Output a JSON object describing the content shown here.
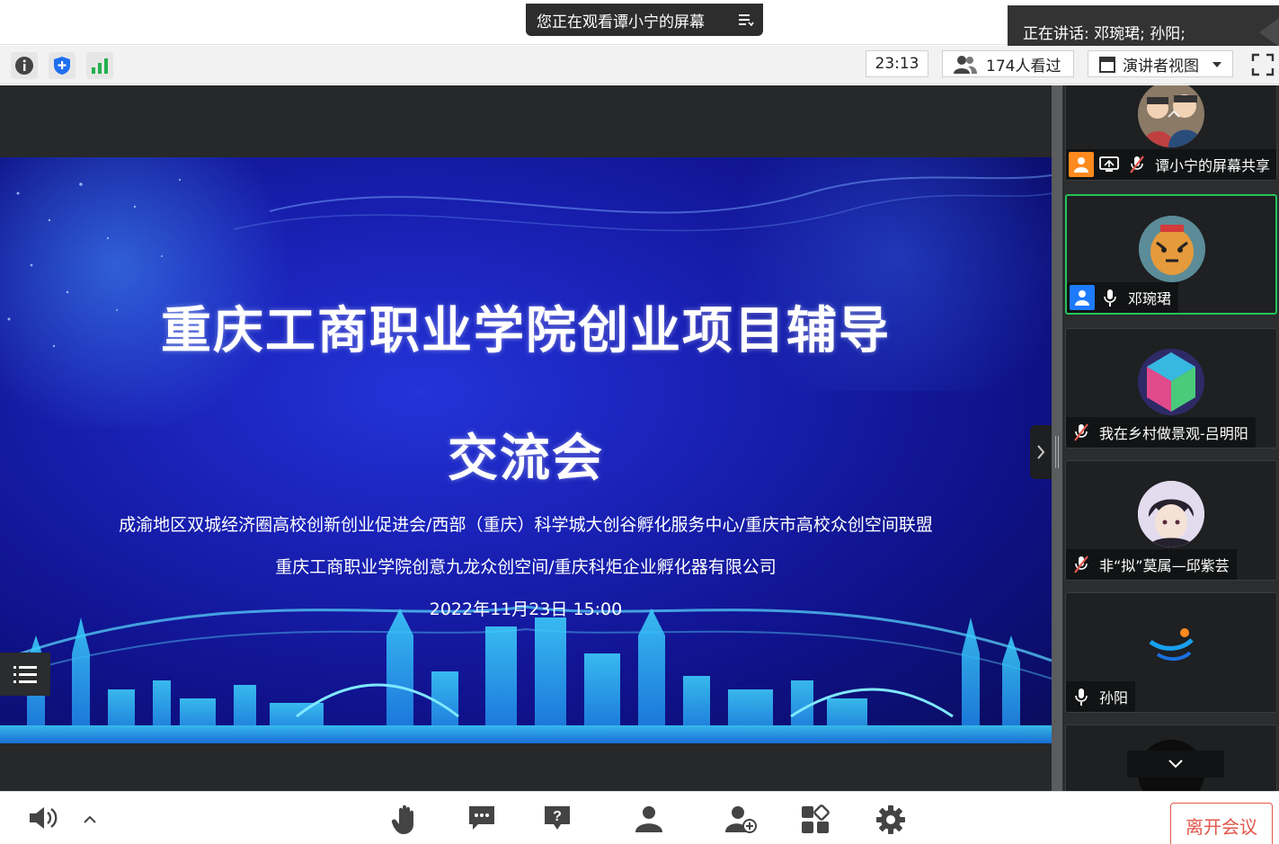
{
  "banner": {
    "watching_text": "您正在观看谭小宁的屏幕"
  },
  "speaking": {
    "text": "正在讲话: 邓琬珺; 孙阳;"
  },
  "toolbar": {
    "timer": "23:13",
    "viewers": "174人看过",
    "view_mode": "演讲者视图"
  },
  "slide": {
    "title_line1": "重庆工商职业学院创业项目辅导",
    "title_line2": "交流会",
    "organizers_line1": "成渝地区双城经济圈高校创新创业促进会/西部（重庆）科学城大创谷孵化服务中心/重庆市高校众创空间联盟",
    "organizers_line2": "重庆工商职业学院创意九龙众创空间/重庆科炬企业孵化器有限公司",
    "datetime": "2022年11月23日  15:00"
  },
  "participants": [
    {
      "name": "谭小宁的屏幕共享",
      "mic": "muted",
      "sharing": true
    },
    {
      "name": "邓琬珺",
      "mic": "on",
      "active": true
    },
    {
      "name": "我在乡村做景观-吕明阳",
      "mic": "muted"
    },
    {
      "name": "非“拟”莫属—邱紫芸",
      "mic": "muted"
    },
    {
      "name": "孙阳",
      "mic": "on"
    }
  ],
  "bottom": {
    "leave_label": "离开会议"
  },
  "colors": {
    "accent_green": "#27c25a",
    "accent_blue": "#1e7bff",
    "leave_red": "#e2574c",
    "slide_blue": "#1a22b8"
  }
}
